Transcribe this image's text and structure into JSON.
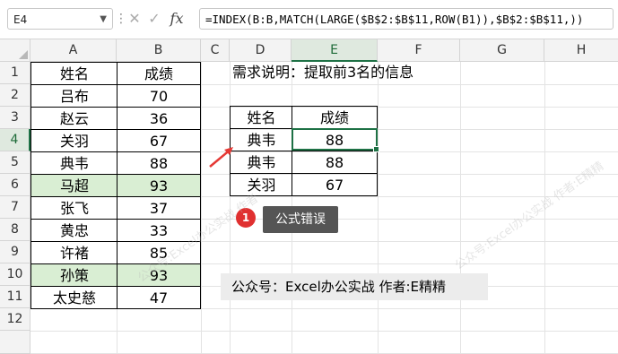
{
  "formula_bar": {
    "name_box": "E4",
    "cancel_icon": "✕",
    "enter_icon": "✓",
    "fx_label": "fx",
    "formula": "=INDEX(B:B,MATCH(LARGE($B$2:$B$11,ROW(B1)),$B$2:$B$11,))"
  },
  "columns": [
    "A",
    "B",
    "C",
    "D",
    "E",
    "F",
    "G",
    "H"
  ],
  "active_column": "E",
  "rows": [
    "1",
    "2",
    "3",
    "4",
    "5",
    "6",
    "7",
    "8",
    "9",
    "10",
    "11",
    "12"
  ],
  "active_row": "4",
  "source_table": {
    "headers": [
      "姓名",
      "成绩"
    ],
    "rows": [
      [
        "吕布",
        "70"
      ],
      [
        "赵云",
        "36"
      ],
      [
        "关羽",
        "67"
      ],
      [
        "典韦",
        "88"
      ],
      [
        "马超",
        "93"
      ],
      [
        "张飞",
        "37"
      ],
      [
        "黄忠",
        "33"
      ],
      [
        "许褚",
        "85"
      ],
      [
        "孙策",
        "93"
      ],
      [
        "太史慈",
        "47"
      ]
    ]
  },
  "requirement_note": "需求说明：提取前3名的信息",
  "result_table": {
    "headers": [
      "姓名",
      "成绩"
    ],
    "rows": [
      [
        "典韦",
        "88"
      ],
      [
        "典韦",
        "88"
      ],
      [
        "关羽",
        "67"
      ]
    ]
  },
  "error_badge": "1",
  "error_label": "公式错误",
  "footer_text": "公众号：Excel办公实战 作者:E精精",
  "watermarks": [
    "公众号:Excel办公实战 作者",
    "公众号:Excel办公实战 作者:E精精"
  ],
  "colors": {
    "highlight": "#d9eed3",
    "selection": "#1e7145",
    "arrow": "#e53935",
    "badge": "#e03030"
  }
}
